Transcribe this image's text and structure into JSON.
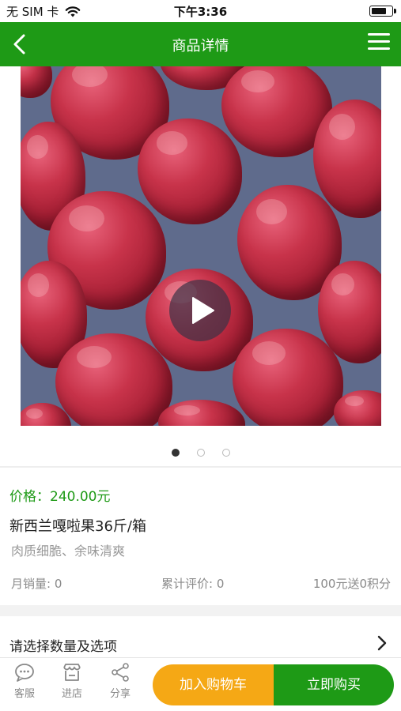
{
  "status_bar": {
    "carrier": "无 SIM 卡",
    "time": "下午3:36",
    "battery_level": 0.8
  },
  "header": {
    "title": "商品详情",
    "back_icon": "chevron-left-icon",
    "menu_icon": "hamburger-menu-icon"
  },
  "gallery": {
    "play_icon": "play-icon",
    "page_count": 3,
    "active_page": 1
  },
  "product": {
    "price": "价格：240.00元",
    "name": "新西兰嘎啦果36斤/箱",
    "description": "肉质细脆、余味清爽",
    "monthly_sales": "月销量: 0",
    "total_reviews": "累计评价: 0",
    "points": "100元送0积分"
  },
  "options": {
    "label": "请选择数量及选项"
  },
  "bottom_bar": {
    "tabs": [
      {
        "label": "客服",
        "icon": "chat-icon"
      },
      {
        "label": "进店",
        "icon": "store-icon"
      },
      {
        "label": "分享",
        "icon": "share-icon"
      }
    ],
    "add_to_cart": "加入购物车",
    "buy_now": "立即购买"
  },
  "colors": {
    "brand_green": "#1e9a16",
    "cart_orange": "#f5a815"
  }
}
